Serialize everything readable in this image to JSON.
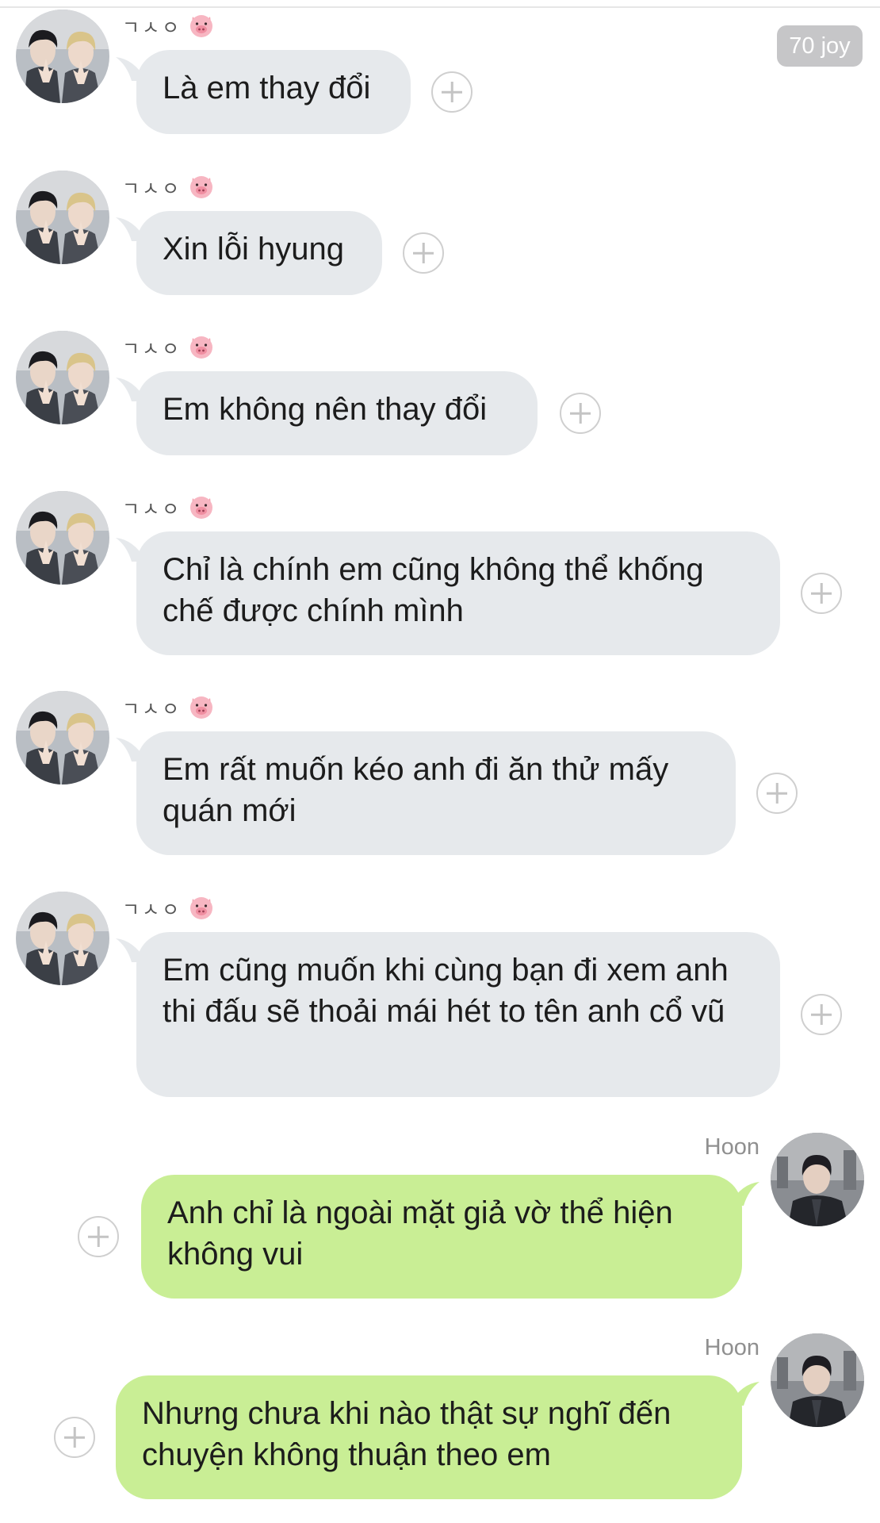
{
  "badge": {
    "label": "70 joy"
  },
  "contact": {
    "name": "ㄱㅅㅇ",
    "emoji_icon": "pig-face-icon"
  },
  "me": {
    "name": "Hoon"
  },
  "messages": [
    {
      "from": "contact",
      "text": "Là em thay đổi"
    },
    {
      "from": "contact",
      "text": "Xin lỗi hyung"
    },
    {
      "from": "contact",
      "text": "Em không nên thay đổi"
    },
    {
      "from": "contact",
      "text": "Chỉ là chính em cũng không thể khống chế được chính mình"
    },
    {
      "from": "contact",
      "text": "Em rất muốn kéo anh đi ăn thử mấy quán mới"
    },
    {
      "from": "contact",
      "text": "Em cũng muốn khi cùng bạn đi xem anh thi đấu sẽ thoải mái hét to tên anh cổ vũ"
    },
    {
      "from": "me",
      "text": "Anh chỉ là ngoài mặt giả vờ thể hiện không vui"
    },
    {
      "from": "me",
      "text": "Nhưng chưa khi nào thật sự nghĩ đến chuyện không thuận theo em"
    }
  ],
  "colors": {
    "incoming_bubble": "#e6e9ec",
    "outgoing_bubble": "#c9ee95",
    "badge": "#c6c6c8"
  }
}
